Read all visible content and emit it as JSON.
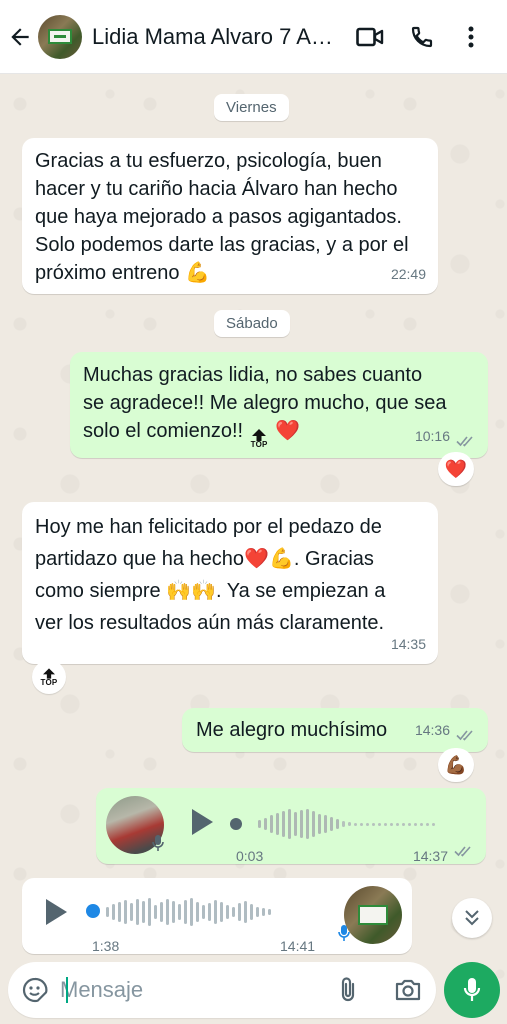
{
  "header": {
    "contact_name": "Lidia Mama Alvaro 7 A…",
    "icons": [
      "back-arrow-icon",
      "video-call-icon",
      "phone-icon",
      "more-vert-icon"
    ]
  },
  "dates": {
    "friday": "Viernes",
    "saturday": "Sábado"
  },
  "messages": {
    "m1": {
      "lines": [
        "Gracias a tu esfuerzo, psicología, buen",
        "hacer y tu cariño hacia Álvaro han hecho",
        "que haya mejorado a pasos agigantados.",
        "Solo podemos darte las gracias, y a por el",
        "próximo entreno"
      ],
      "emoji": "💪",
      "time": "22:49"
    },
    "m2": {
      "lines": [
        "Muchas gracias lidia, no sabes cuanto",
        "se agradece!! Me alegro mucho, que sea",
        "solo el comienzo!!"
      ],
      "top_badge": "TOP",
      "emoji": "❤️",
      "time": "10:16",
      "reaction": "❤️"
    },
    "m3": {
      "lines": [
        "Hoy me han felicitado por el pedazo de",
        "partidazo que ha hecho",
        ". Gracias",
        "como siempre",
        ". Ya se empiezan a",
        "ver los resultados aún más claramente."
      ],
      "emoji_heart": "❤️",
      "emoji_muscle": "💪",
      "emoji_hands": "🙌🙌",
      "time": "14:35",
      "reaction_top": "TOP"
    },
    "m4": {
      "text": "Me alegro muchísimo",
      "time": "14:36",
      "reaction": "💪🏾"
    },
    "voice_out": {
      "duration": "0:03",
      "time": "14:37"
    },
    "voice_in": {
      "duration": "1:38",
      "time": "14:41"
    }
  },
  "input": {
    "placeholder": "Mensaje"
  },
  "colors": {
    "outgoing_bubble": "#d9fdd3",
    "incoming_bubble": "#ffffff",
    "chat_background": "#efeae2",
    "accent_green": "#1daa61",
    "tick_gray": "#8696a0",
    "voice_dot_blue": "#1e88e5"
  }
}
